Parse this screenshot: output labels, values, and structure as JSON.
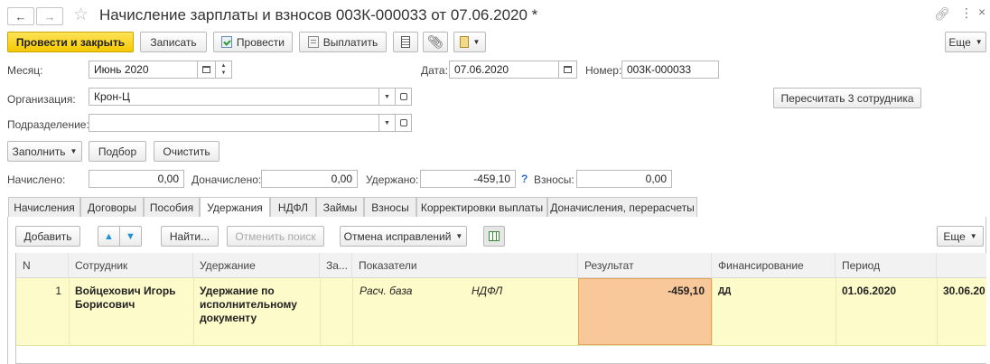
{
  "title": "Начисление зарплаты и взносов 003К-000033 от 07.06.2020 *",
  "toolbar": {
    "post_and_close": "Провести и закрыть",
    "save": "Записать",
    "post": "Провести",
    "pay": "Выплатить",
    "more": "Еще"
  },
  "form": {
    "month_label": "Месяц:",
    "month_value": "Июнь 2020",
    "date_label": "Дата:",
    "date_value": "07.06.2020",
    "number_label": "Номер:",
    "number_value": "003К-000033",
    "org_label": "Организация:",
    "org_value": "Крон-Ц",
    "dept_label": "Подразделение:",
    "dept_value": "",
    "recalc_button": "Пересчитать 3 сотрудника",
    "fill_button": "Заполнить",
    "select_button": "Подбор",
    "clear_button": "Очистить"
  },
  "totals": {
    "accrued_label": "Начислено:",
    "accrued_value": "0,00",
    "extra_label": "Доначислено:",
    "extra_value": "0,00",
    "withheld_label": "Удержано:",
    "withheld_value": "-459,10",
    "help_mark": "?",
    "contrib_label": "Взносы:",
    "contrib_value": "0,00"
  },
  "tabs": [
    "Начисления",
    "Договоры",
    "Пособия",
    "Удержания",
    "НДФЛ",
    "Займы",
    "Взносы",
    "Корректировки выплаты",
    "Доначисления, перерасчеты"
  ],
  "active_tab": "Удержания",
  "table_toolbar": {
    "add": "Добавить",
    "find": "Найти...",
    "cancel_search": "Отменить поиск",
    "cancel_fixes": "Отмена исправлений",
    "more": "Еще"
  },
  "table": {
    "columns": [
      "N",
      "Сотрудник",
      "Удержание",
      "За...",
      "Показатели",
      "Результат",
      "Финансирование",
      "Период"
    ],
    "rows": [
      {
        "n": "1",
        "employee": "Войцехович Игорь Борисович",
        "deduction": "Удержание по исполнительному документу",
        "indicator_name": "Расч. база",
        "indicator_value": "НДФЛ",
        "result": "-459,10",
        "financing": "ДД",
        "period_start": "01.06.2020",
        "period_end": "30.06.20"
      }
    ]
  },
  "colors": {
    "accent_yellow": "#f5c900",
    "row_highlight": "#fdfbc9",
    "result_cell": "#f8c89a"
  }
}
